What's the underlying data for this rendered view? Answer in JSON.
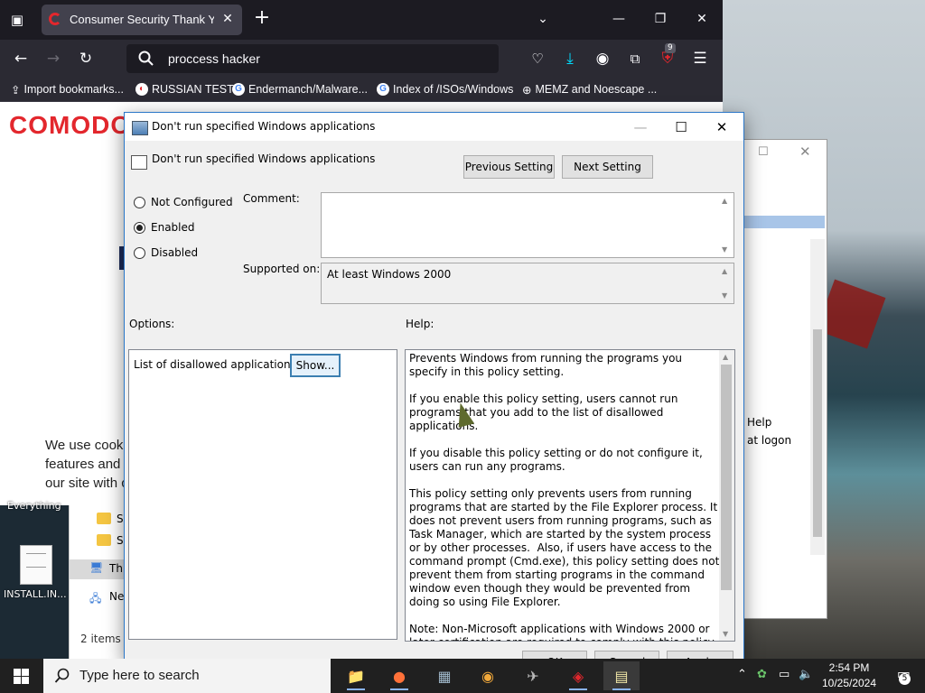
{
  "browser": {
    "tab_title": "Consumer Security Thank You f",
    "url_text": "proccess hacker",
    "notification_count": "9",
    "bookmarks": [
      {
        "label": "Import bookmarks..."
      },
      {
        "label": "RUSSIAN TEST"
      },
      {
        "label": "Endermanch/Malware..."
      },
      {
        "label": "Index of /ISOs/Windows"
      },
      {
        "label": "MEMZ and Noescape ..."
      }
    ],
    "page": {
      "logo": "COMODO",
      "cookie_lines": [
        "We use cook",
        "features and t",
        "our site with c"
      ]
    }
  },
  "desktop": {
    "everything_label": "Everything",
    "install_label": "INSTALL.IN..."
  },
  "explorer": {
    "items": [
      {
        "label": "Sc"
      },
      {
        "label": "Sp"
      },
      {
        "label": "This"
      },
      {
        "label": "Net"
      }
    ],
    "status": "2 items"
  },
  "background_window": {
    "help": "Help",
    "logon": "at logon"
  },
  "dialog": {
    "title": "Don't run specified Windows applications",
    "header_title": "Don't run specified Windows applications",
    "previous_setting": "Previous Setting",
    "next_setting": "Next Setting",
    "radios": [
      {
        "label": "Not Configured",
        "selected": false
      },
      {
        "label": "Enabled",
        "selected": true
      },
      {
        "label": "Disabled",
        "selected": false
      }
    ],
    "comment_label": "Comment:",
    "comment_value": "",
    "supported_label": "Supported on:",
    "supported_value": "At least Windows 2000",
    "options_label": "Options:",
    "help_label": "Help:",
    "option_list_label": "List of disallowed applications",
    "show_button": "Show...",
    "help_text": "Prevents Windows from running the programs you specify in this policy setting.\n\nIf you enable this policy setting, users cannot run programs that you add to the list of disallowed applications.\n\nIf you disable this policy setting or do not configure it, users can run any programs.\n\nThis policy setting only prevents users from running programs that are started by the File Explorer process. It does not prevent users from running programs, such as Task Manager, which are started by the system process or by other processes.  Also, if users have access to the command prompt (Cmd.exe), this policy setting does not prevent them from starting programs in the command window even though they would be prevented from doing so using File Explorer.\n\nNote: Non-Microsoft applications with Windows 2000 or later certification are required to comply with this policy setting.\nNote: To create a list of allowed applications, click Show.  In the",
    "ok": "OK",
    "cancel": "Cancel",
    "apply": "Apply"
  },
  "taskbar": {
    "search_placeholder": "Type here to search",
    "time": "2:54 PM",
    "date": "10/25/2024",
    "notifications": "5"
  },
  "colors": {
    "accent": "#2b77c8",
    "comodo_red": "#e3272d",
    "firefox_dark": "#1c1b22"
  }
}
